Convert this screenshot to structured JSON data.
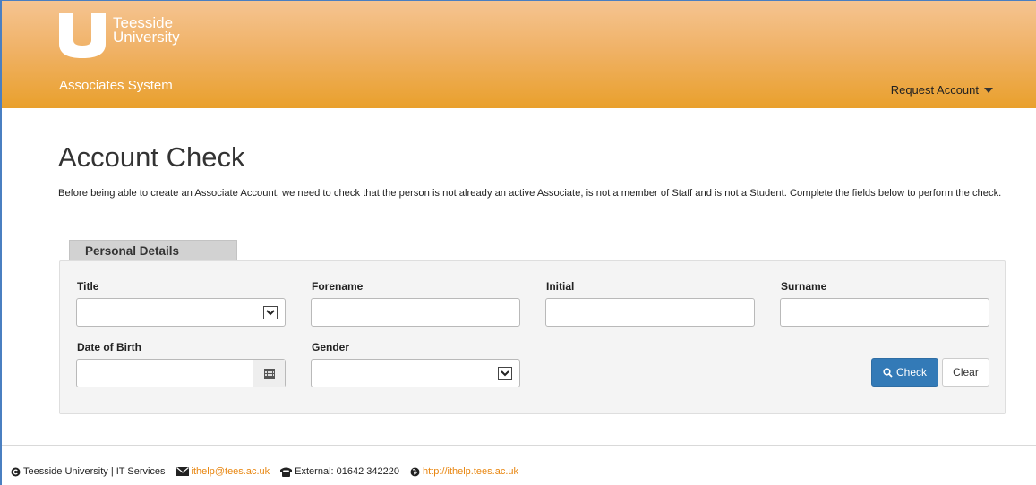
{
  "header": {
    "logo_line1": "Teesside",
    "logo_line2": "University",
    "system_name": "Associates System",
    "nav_request_account": "Request Account",
    "colors": {
      "header_top": "#f5c491",
      "header_bottom": "#e9a02c"
    }
  },
  "main": {
    "title": "Account Check",
    "intro": "Before being able to create an Associate Account, we need to check that the person is not already an active Associate, is not a member of Staff and is not a Student. Complete the fields below to perform the check."
  },
  "form": {
    "tab_label": "Personal Details",
    "title_label": "Title",
    "title_value": "",
    "forename_label": "Forename",
    "forename_value": "",
    "initial_label": "Initial",
    "initial_value": "",
    "surname_label": "Surname",
    "surname_value": "",
    "dob_label": "Date of Birth",
    "dob_value": "",
    "gender_label": "Gender",
    "gender_value": "",
    "check_button": "Check",
    "clear_button": "Clear",
    "colors": {
      "check_button": "#337ab7"
    }
  },
  "footer": {
    "copyright": "Teesside University | IT Services",
    "email": "ithelp@tees.ac.uk",
    "phone": "External: 01642 342220",
    "website": "http://ithelp.tees.ac.uk",
    "link_color": "#e8850e",
    "icons": [
      "copyright-icon",
      "email-icon",
      "phone-icon",
      "globe-icon"
    ]
  }
}
